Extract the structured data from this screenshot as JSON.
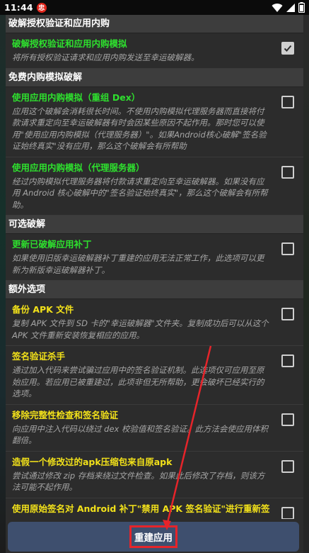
{
  "status_bar": {
    "time": "11:44",
    "app_badge": "忠",
    "icons": [
      "wifi-icon",
      "signal-icon",
      "battery-icon"
    ]
  },
  "colors": {
    "section_header_bg": "#3d3d3d",
    "dialog_bg": "#2c2c2c",
    "title_green": "#2ee02e",
    "title_yellow": "#f2e11a",
    "desc_gray": "#a6a6a6",
    "button_bg": "#3e4f6e",
    "annotation_red": "#e6242a"
  },
  "sections": [
    {
      "header": "破解授权验证和应用内购",
      "options": [
        {
          "title": "破解授权验证和应用内购模拟",
          "color": "green",
          "checked": true,
          "desc": "将所有授权验证请求和应用内购发送至幸运破解器。"
        }
      ]
    },
    {
      "header": "免费内购模拟破解",
      "options": [
        {
          "title": "使用应用内购模拟（重组 Dex）",
          "color": "green",
          "checked": false,
          "desc": "应用这个破解会消耗很长时间。不使用内购模拟代理服务器而直接将付款请求重定向至幸运破解器有时会因某些原因不起作用。那时您可以使用\"使用应用内购模拟（代理服务器）\"。如果Android核心破解\"签名验证始终真实\"没有应用，那么这个破解会有所帮助"
        },
        {
          "title": "使用应用内购模拟（代理服务器）",
          "color": "green",
          "checked": false,
          "desc": "经过内购模拟代理服务器将付款请求重定向至幸运破解器。如果没有应用 Android 核心破解中的\"签名验证始终真实\"，那么这个破解会有所帮助。"
        }
      ]
    },
    {
      "header": "可选破解",
      "options": [
        {
          "title": "更新已破解应用补丁",
          "color": "green",
          "checked": false,
          "desc": "如果使用旧版幸运破解器补丁重建的应用无法正常工作，此选项可以更新为新版幸运破解器补丁。"
        }
      ]
    },
    {
      "header": "额外选项",
      "options": [
        {
          "title": "备份 APK 文件",
          "color": "yellow",
          "checked": false,
          "desc": "复制 APK 文件到 SD 卡的\"幸运破解器\"文件夹。复制成功后可以从这个 APK 文件重新安装恢复相应的应用。"
        },
        {
          "title": "签名验证杀手",
          "color": "yellow",
          "checked": false,
          "desc": "通过加入代码来尝试骗过应用中的签名验证机制。此选项仅可应用至原始应用。若应用已被重建过，此项非但无所帮助，更会破坏已经实行的选项。"
        },
        {
          "title": "移除完整性检查和签名验证",
          "color": "yellow",
          "checked": false,
          "desc": "向应用中注入代码以绕过 dex 校验值和签名验证。此方法会使应用体积翻倍。"
        },
        {
          "title": "造假一个修改过的apk压缩包来自原apk",
          "color": "yellow",
          "checked": false,
          "desc": "尝试通过修改 zip 存档来绕过文件检查。如果此后修改了存档，则该方法可能不起作用。"
        },
        {
          "title": "使用原始签名对 Android 补丁\"禁用 APK 签名验证\"进行重新签",
          "color": "yellow",
          "checked": false,
          "desc": ""
        }
      ]
    }
  ],
  "rebuild_button": {
    "label": "重建应用"
  }
}
